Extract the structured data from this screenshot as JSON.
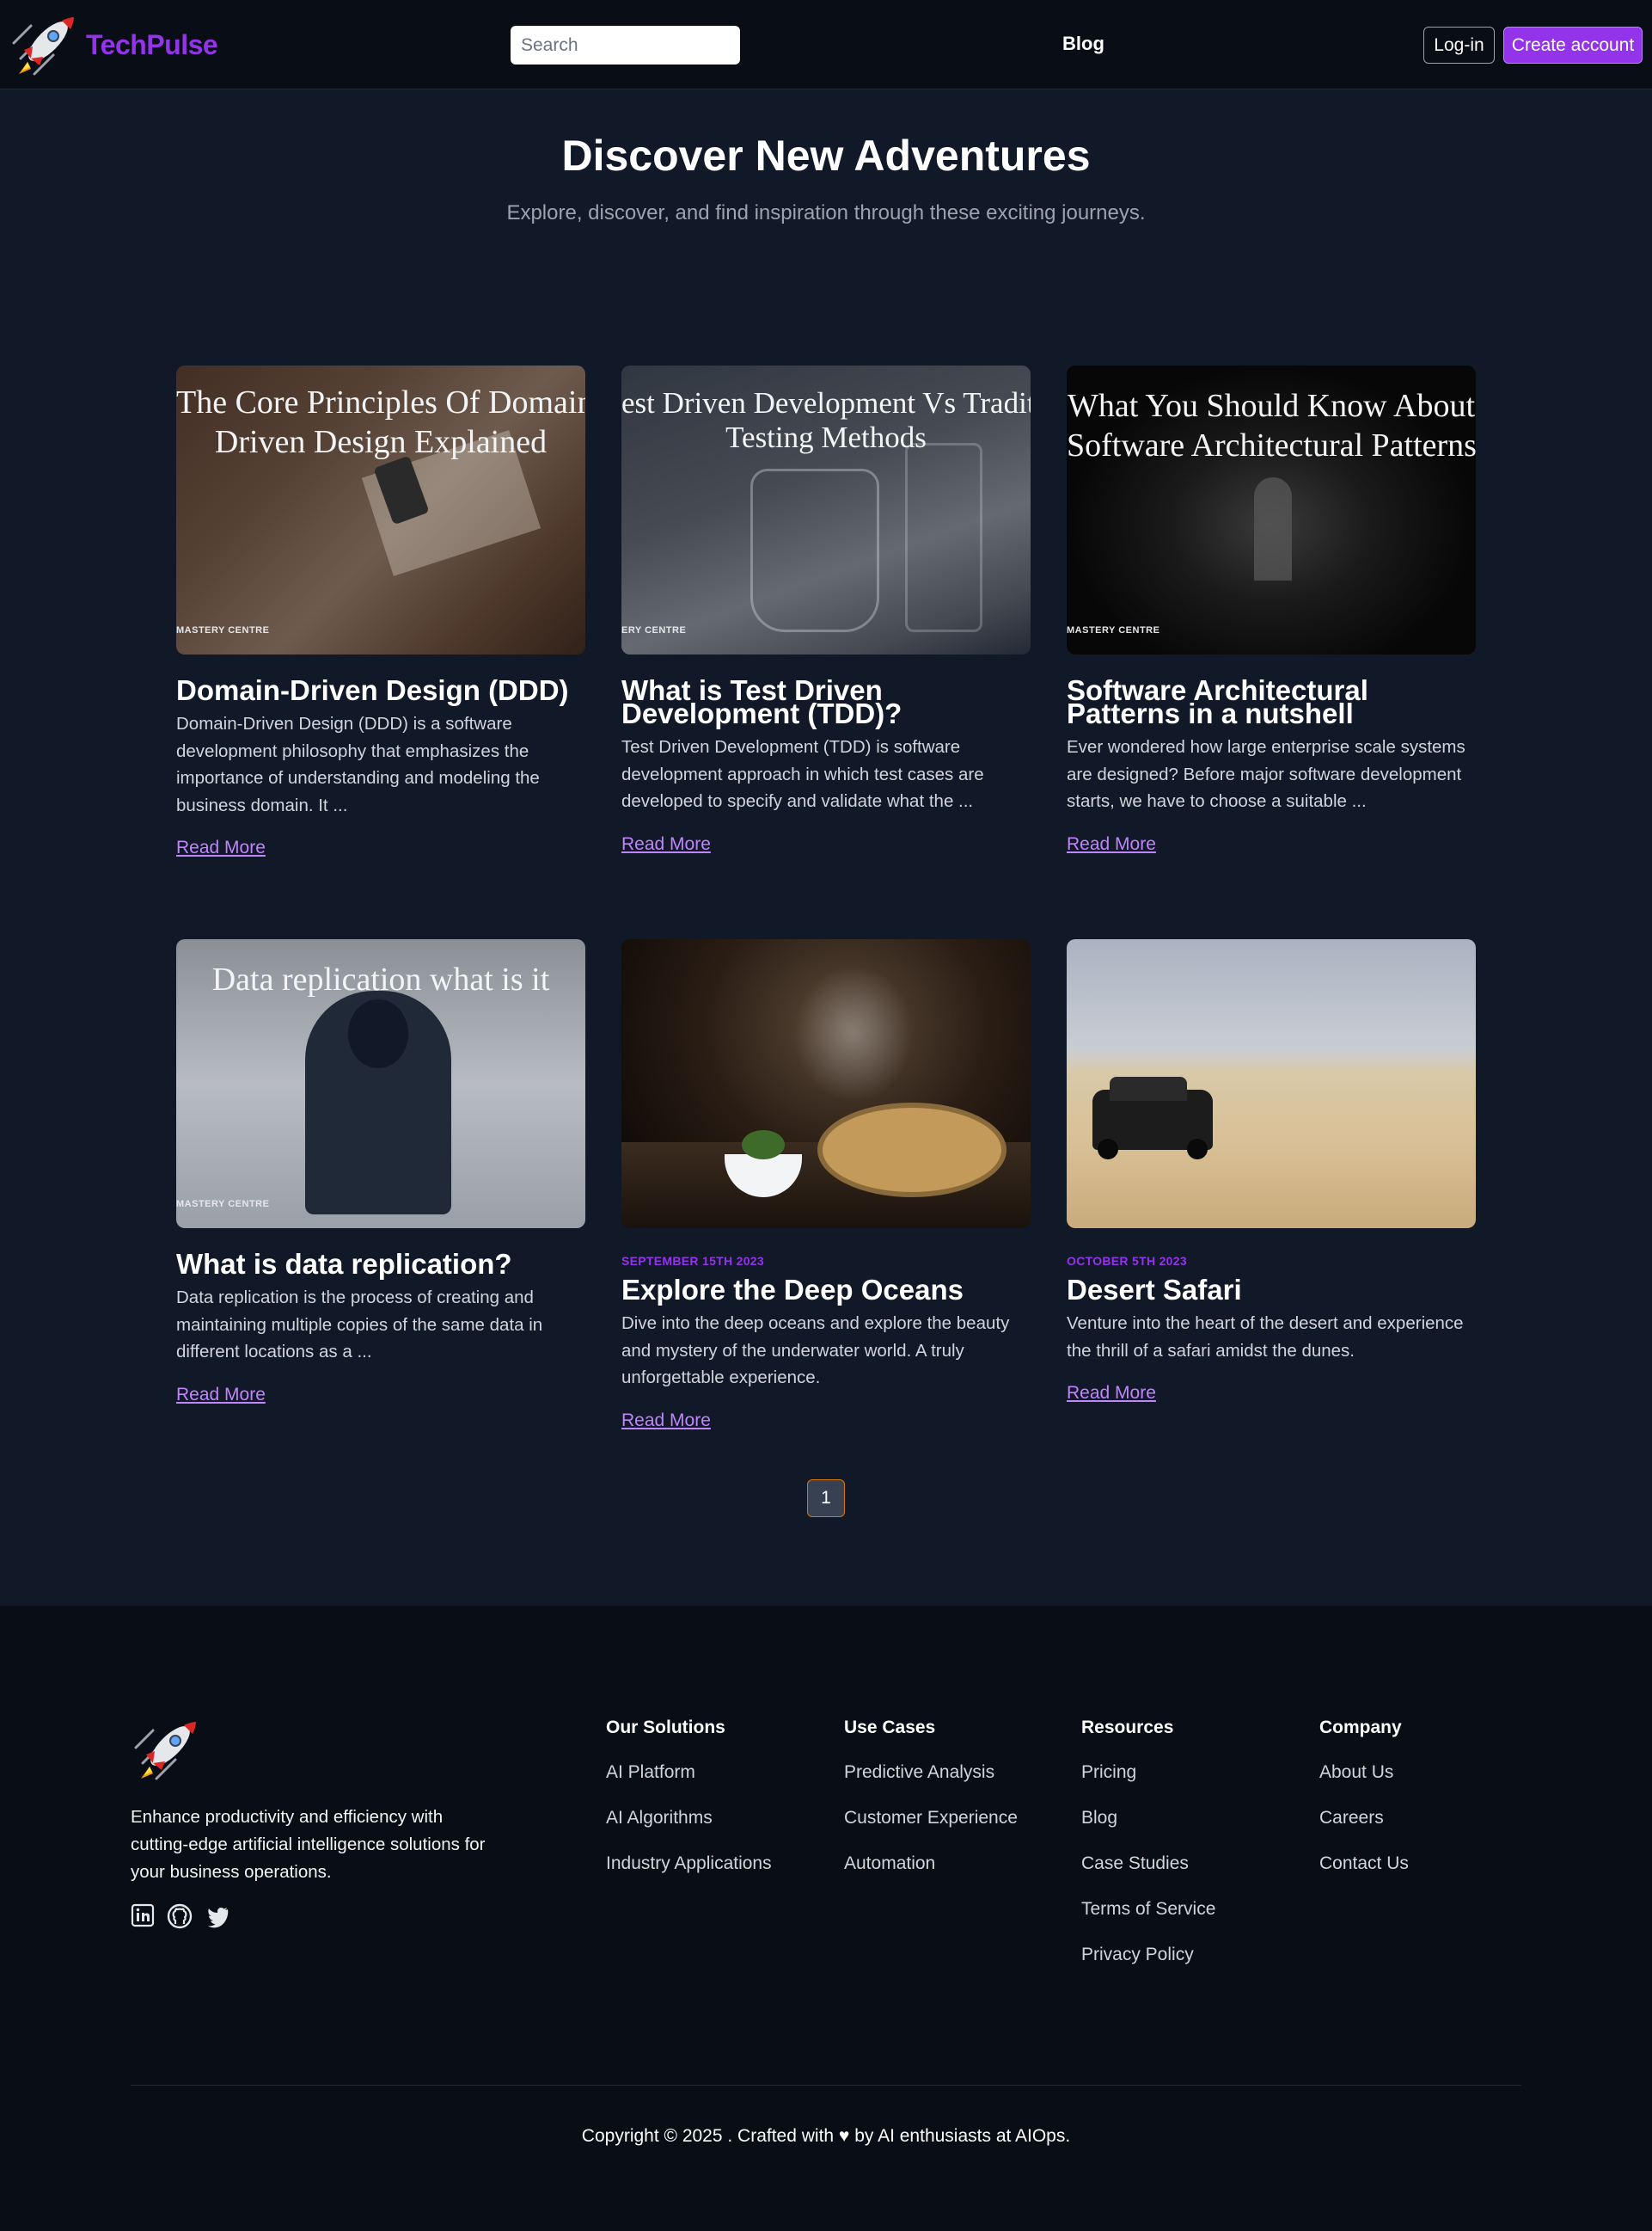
{
  "header": {
    "brand": "TechPulse",
    "search_placeholder": "Search",
    "nav_blog": "Blog",
    "login_label": "Log-in",
    "create_label": "Create account"
  },
  "hero": {
    "title": "Discover New Adventures",
    "subtitle": "Explore, discover, and find inspiration through these exciting journeys."
  },
  "posts": [
    {
      "image_text_1": "The Core Principles Of Domain",
      "image_text_2": "Driven Design Explained",
      "image_badge": "MASTERY CENTRE",
      "title": "Domain-Driven Design (DDD)",
      "date": "",
      "desc": "Domain-Driven Design (DDD) is a software development philosophy that emphasizes the importance of understanding and modeling the business domain. It ...",
      "link": "Read More"
    },
    {
      "image_text_1": "est Driven Development Vs Tradition",
      "image_text_2": "Testing Methods",
      "image_badge": "ERY CENTRE",
      "title": "What is Test Driven Development (TDD)?",
      "date": "",
      "desc": "Test Driven Development (TDD) is software development approach in which test cases are developed to specify and validate what the ...",
      "link": "Read More"
    },
    {
      "image_text_1": "What You Should Know About",
      "image_text_2": "Software Architectural Patterns",
      "image_badge": "MASTERY CENTRE",
      "title": "Software Architectural Patterns in a nutshell",
      "date": "",
      "desc": "Ever wondered how large enterprise scale systems are designed? Before major software development starts, we have to choose a suitable ...",
      "link": "Read More"
    },
    {
      "image_text_1": "Data replication what is it",
      "image_text_2": "",
      "image_badge": "MASTERY CENTRE",
      "title": "What is data replication?",
      "date": "",
      "desc": "Data replication is the process of creating and maintaining multiple copies of the same data in different locations as a ...",
      "link": "Read More"
    },
    {
      "image_text_1": "",
      "image_text_2": "",
      "image_badge": "",
      "title": "Explore the Deep Oceans",
      "date": "SEPTEMBER 15TH 2023",
      "desc": "Dive into the deep oceans and explore the beauty and mystery of the underwater world. A truly unforgettable experience.",
      "link": "Read More"
    },
    {
      "image_text_1": "",
      "image_text_2": "",
      "image_badge": "",
      "title": "Desert Safari",
      "date": "OCTOBER 5TH 2023",
      "desc": "Venture into the heart of the desert and experience the thrill of a safari amidst the dunes.",
      "link": "Read More"
    }
  ],
  "pagination": {
    "current": "1"
  },
  "footer": {
    "description": "Enhance productivity and efficiency with cutting-edge artificial intelligence solutions for your business operations.",
    "columns": [
      {
        "title": "Our Solutions",
        "links": [
          "AI Platform",
          "AI Algorithms",
          "Industry Applications"
        ]
      },
      {
        "title": "Use Cases",
        "links": [
          "Predictive Analysis",
          "Customer Experience",
          "Automation"
        ]
      },
      {
        "title": "Resources",
        "links": [
          "Pricing",
          "Blog",
          "Case Studies",
          "Terms of Service",
          "Privacy Policy"
        ]
      },
      {
        "title": "Company",
        "links": [
          "About Us",
          "Careers",
          "Contact Us"
        ]
      }
    ],
    "copyright": "Copyright © 2025 . Crafted with ♥ by AI enthusiasts at AIOps."
  },
  "colors": {
    "accent": "#9333ea",
    "link": "#c084fc",
    "background": "#111827",
    "header_bg": "#090d16"
  },
  "icons": [
    "rocket-icon",
    "search-icon",
    "linkedin-icon",
    "github-icon",
    "twitter-icon"
  ]
}
